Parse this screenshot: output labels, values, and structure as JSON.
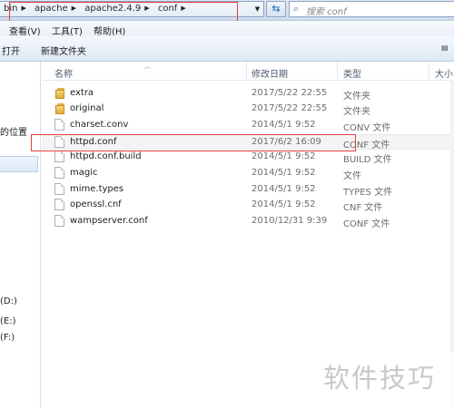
{
  "address_bar": {
    "crumbs": [
      "bin",
      "apache",
      "apache2.4.9",
      "conf"
    ],
    "search_placeholder": "搜索 conf"
  },
  "menu": {
    "items": [
      "查看(V)",
      "工具(T)",
      "帮助(H)"
    ]
  },
  "toolbar": {
    "open_label": "打开",
    "new_folder_label": "新建文件夹"
  },
  "nav": {
    "recent_places_label": "的位置",
    "drives": [
      "(D:)",
      "(E:)",
      "(F:)"
    ]
  },
  "columns": {
    "name": "名称",
    "modified": "修改日期",
    "type": "类型",
    "size": "大小"
  },
  "files": [
    {
      "name": "extra",
      "modified": "2017/5/22 22:55",
      "type": "文件夹",
      "icon": "folder-icon"
    },
    {
      "name": "original",
      "modified": "2017/5/22 22:55",
      "type": "文件夹",
      "icon": "folder-icon"
    },
    {
      "name": "charset.conv",
      "modified": "2014/5/1 9:52",
      "type": "CONV 文件",
      "icon": "file-icon"
    },
    {
      "name": "httpd.conf",
      "modified": "2017/6/2 16:09",
      "type": "CONF 文件",
      "icon": "file-icon"
    },
    {
      "name": "httpd.conf.build",
      "modified": "2014/5/1 9:52",
      "type": "BUILD 文件",
      "icon": "file-icon"
    },
    {
      "name": "magic",
      "modified": "2014/5/1 9:52",
      "type": "文件",
      "icon": "file-icon"
    },
    {
      "name": "mime.types",
      "modified": "2014/5/1 9:52",
      "type": "TYPES 文件",
      "icon": "file-icon"
    },
    {
      "name": "openssl.cnf",
      "modified": "2014/5/1 9:52",
      "type": "CNF 文件",
      "icon": "file-icon"
    },
    {
      "name": "wampserver.conf",
      "modified": "2010/12/31 9:39",
      "type": "CONF 文件",
      "icon": "file-icon"
    }
  ],
  "watermark": "软件技巧",
  "colors": {
    "highlight_box": "#e04040",
    "folder": "#e1ac3b",
    "chrome_blue": "#cddcee"
  }
}
